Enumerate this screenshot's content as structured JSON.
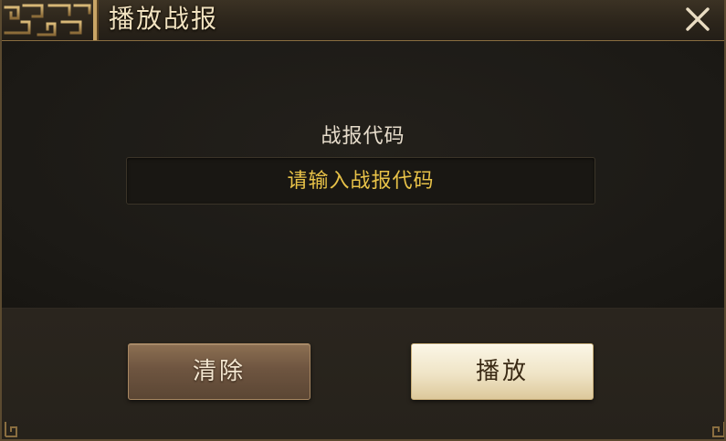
{
  "dialog": {
    "title": "播放战报",
    "close_icon": "close-icon"
  },
  "form": {
    "label": "战报代码",
    "input_value": "",
    "input_placeholder": "请输入战报代码"
  },
  "buttons": {
    "clear_label": "清除",
    "play_label": "播放"
  },
  "colors": {
    "title_text": "#f1e2c0",
    "placeholder_text": "#e8c248",
    "frame_gold": "#8a6e40"
  }
}
